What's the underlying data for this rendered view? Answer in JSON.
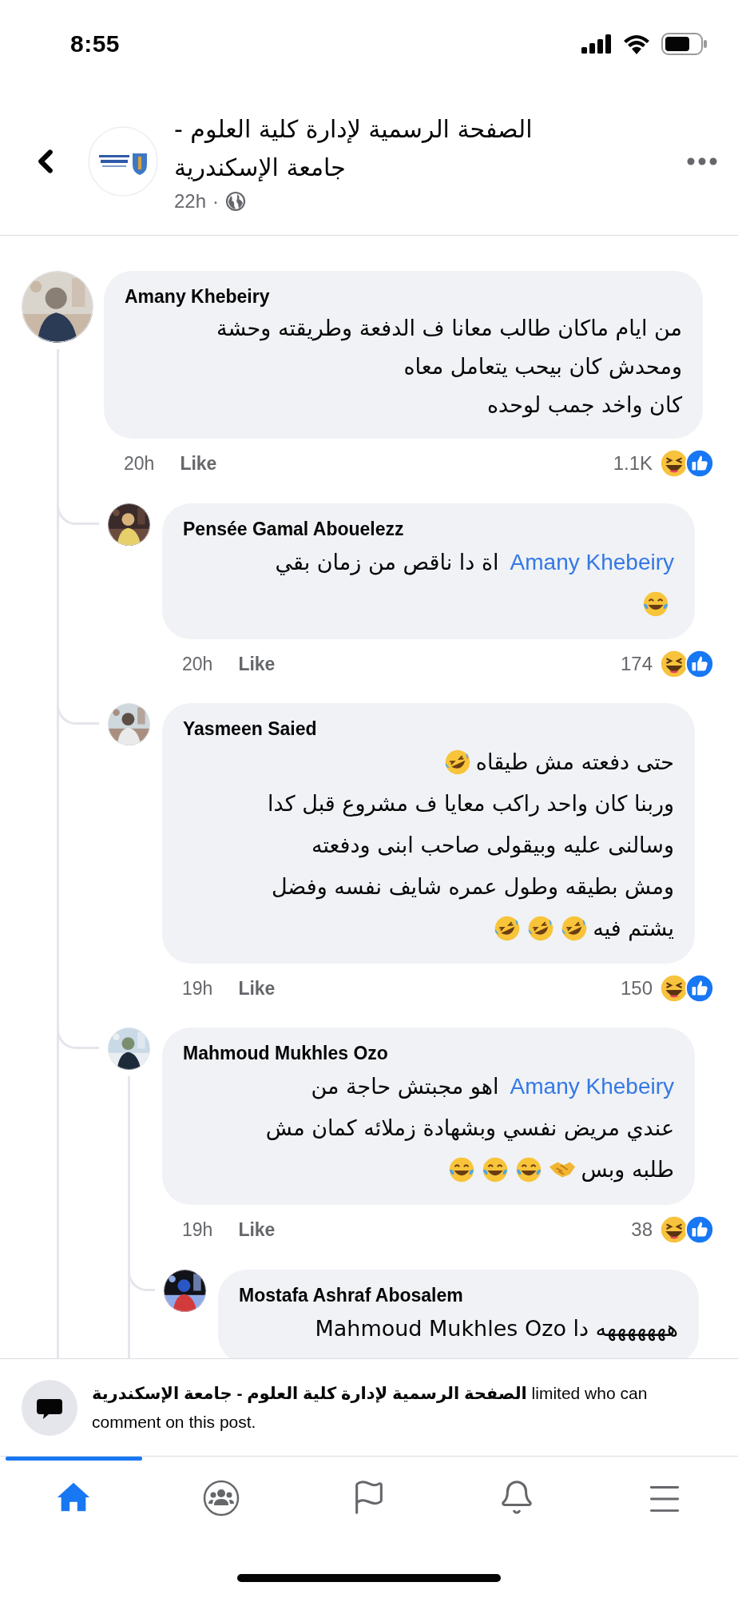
{
  "status_bar": {
    "time": "8:55"
  },
  "header": {
    "title_lines": [
      "الصفحة الرسمية لإدارة كلية العلوم -",
      "جامعة الإسكندرية"
    ],
    "time": "22h",
    "separator": "·"
  },
  "comments": [
    {
      "author": "Amany Khebeiry",
      "lines": [
        [
          {
            "kind": "text",
            "text": "من ايام ماكان طالب معانا ف الدفعة وطريقته وحشة"
          }
        ],
        [
          {
            "kind": "text",
            "text": "ومحدش كان بيحب يتعامل معاه"
          }
        ],
        [
          {
            "kind": "text",
            "text": "كان واخد جمب لوحده"
          }
        ]
      ],
      "time": "20h",
      "like": "Like",
      "reaction_count": "1.1K",
      "reactions": [
        {
          "kind": "haha"
        },
        {
          "kind": "like"
        }
      ],
      "replies": [
        {
          "author": "Pensée Gamal Abouelezz",
          "lines": [
            [
              {
                "kind": "mention",
                "text": "Amany Khebeiry"
              },
              {
                "kind": "text",
                "text": "اة دا ناقص من زمان بقي"
              }
            ],
            [
              {
                "kind": "joy_emoji"
              }
            ]
          ],
          "time": "20h",
          "like": "Like",
          "reaction_count": "174",
          "reactions": [
            {
              "kind": "haha"
            },
            {
              "kind": "like"
            }
          ]
        },
        {
          "author": "Yasmeen Saied",
          "lines": [
            [
              {
                "kind": "text",
                "text": "حتى دفعته مش طيقاه"
              },
              {
                "kind": "rofl_emoji"
              }
            ],
            [
              {
                "kind": "text",
                "text": "وربنا كان واحد راكب معايا ف مشروع قبل كدا"
              }
            ],
            [
              {
                "kind": "text",
                "text": "وسالنى عليه وبيقولى صاحب ابنى ودفعته"
              }
            ],
            [
              {
                "kind": "text",
                "text": "ومش بطيقه وطول عمره شايف نفسه وفضل"
              }
            ],
            [
              {
                "kind": "text",
                "text": "يشتم فيه"
              },
              {
                "kind": "rofl_emoji"
              },
              {
                "kind": "rofl_emoji"
              },
              {
                "kind": "rofl_emoji"
              }
            ]
          ],
          "time": "19h",
          "like": "Like",
          "reaction_count": "150",
          "reactions": [
            {
              "kind": "haha"
            },
            {
              "kind": "like"
            }
          ]
        },
        {
          "author": "Mahmoud Mukhles Ozo",
          "lines": [
            [
              {
                "kind": "mention",
                "text": "Amany Khebeiry"
              },
              {
                "kind": "text",
                "text": "اهو مجبتش حاجة من"
              }
            ],
            [
              {
                "kind": "text",
                "text": "عندي مريض نفسي وبشهادة زملائه كمان مش"
              }
            ],
            [
              {
                "kind": "text",
                "text": "طلبه وبس"
              },
              {
                "kind": "handshake_emoji"
              },
              {
                "kind": "joy_emoji"
              },
              {
                "kind": "joy_emoji"
              },
              {
                "kind": "joy_emoji"
              }
            ]
          ],
          "time": "19h",
          "like": "Like",
          "reaction_count": "38",
          "reactions": [
            {
              "kind": "haha"
            },
            {
              "kind": "like"
            }
          ],
          "replies": [
            {
              "author": "Mostafa Ashraf Abosalem",
              "lines": [
                [
                  {
                    "kind": "text",
                    "text": "هههههههه دا Mahmoud Mukhles Ozo"
                  }
                ]
              ]
            }
          ]
        }
      ]
    }
  ],
  "notice": {
    "lines": [
      "**الصفحة الرسمية لإدارة كلية العلوم - جامعة الإسكندرية** limited who can",
      "comment on this post."
    ]
  },
  "nav": [
    {
      "kind": "home",
      "selected": true
    },
    {
      "kind": "groups",
      "selected": false
    },
    {
      "kind": "pages",
      "selected": false
    },
    {
      "kind": "notifications",
      "selected": false
    },
    {
      "kind": "menu",
      "selected": false
    }
  ]
}
